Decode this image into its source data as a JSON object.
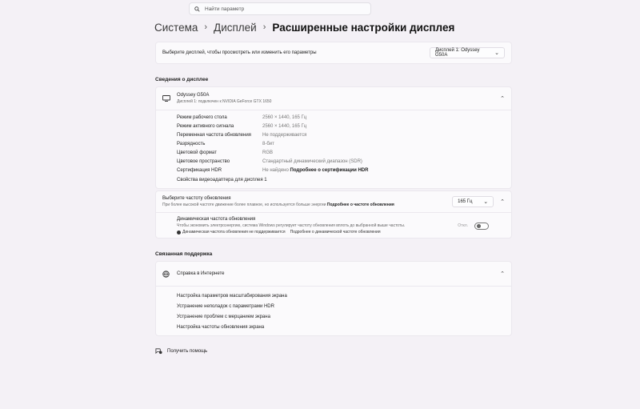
{
  "search": {
    "placeholder": "Найти параметр"
  },
  "breadcrumb": {
    "items": [
      "Система",
      "Дисплей"
    ],
    "current": "Расширенные настройки дисплея"
  },
  "display_select": {
    "label": "Выберите дисплей, чтобы просмотреть или изменить его параметры",
    "value": "Дисплей 1: Odyssey G50A"
  },
  "display_info": {
    "section_title": "Сведения о дисплее",
    "monitor_name": "Odyssey G50A",
    "monitor_sub": "Дисплей 1: подключен к NVIDIA GeForce GTX 1650",
    "properties": [
      {
        "key": "Режим рабочего стола",
        "value": "2560 × 1440, 165 Гц"
      },
      {
        "key": "Режим активного сигнала",
        "value": "2560 × 1440, 165 Гц"
      },
      {
        "key": "Переменная частота обновления",
        "value": "Не поддерживается"
      },
      {
        "key": "Разрядность",
        "value": "8-бит"
      },
      {
        "key": "Цветовой формат",
        "value": "RGB"
      },
      {
        "key": "Цветовое пространство",
        "value": "Стандартный динамический диапазон (SDR)"
      },
      {
        "key": "Сертификация HDR",
        "value": "Не найдено",
        "link": "Подробнее о сертификации HDR"
      }
    ],
    "adapter_link": "Свойства видеоадаптера для дисплея 1"
  },
  "refresh": {
    "title": "Выберите частоту обновления",
    "subtitle": "При более высокой частоте движение более плавное, но используется больше энергии",
    "link": "Подробнее о частоте обновления",
    "value": "165 Гц"
  },
  "dynamic_refresh": {
    "title": "Динамическая частота обновления",
    "subtitle": "Чтобы экономить электроэнергию, система Windows регулирует частоту обновления вплоть до выбранной выше частоты.",
    "warning": "Динамическая частота обновления не поддерживается",
    "link": "Подробнее о динамической частоте обновления",
    "toggle_label": "Откл."
  },
  "support": {
    "section_title": "Связанная поддержка",
    "help_title": "Справка в Интернете",
    "links": [
      "Настройка параметров масштабирования экрана",
      "Устранение неполадок с параметрами HDR",
      "Устранение проблем с мерцанием экрана",
      "Настройка частоты обновления экрана"
    ]
  },
  "get_help": "Получить помощь"
}
